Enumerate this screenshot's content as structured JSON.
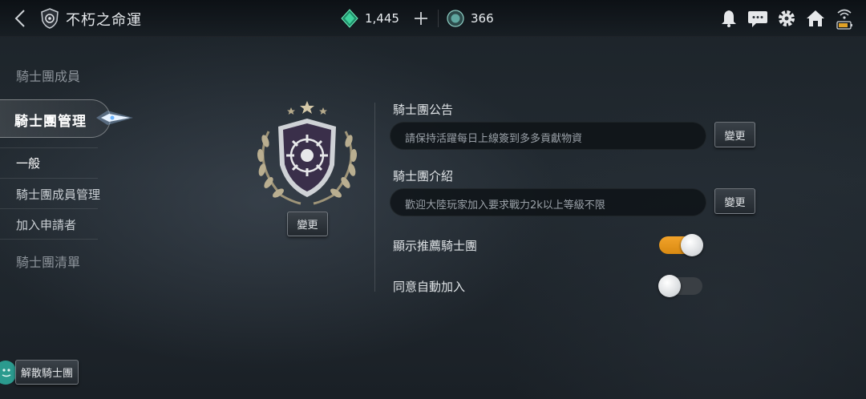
{
  "header": {
    "title": "不朽之命運",
    "currency": [
      {
        "name": "green-gem",
        "amount": "1,445",
        "color": "#2fbf8c"
      },
      {
        "name": "teal-coin",
        "amount": "366",
        "color": "#5fa7a0"
      }
    ]
  },
  "sidebar": {
    "members": "騎士團成員",
    "management": "騎士團管理",
    "sub": [
      "一般",
      "騎士團成員管理",
      "加入申請者"
    ],
    "list": "騎士團清單"
  },
  "emblem": {
    "change_label": "變更"
  },
  "notice": {
    "label": "騎士團公告",
    "value": "請保持活躍每日上線簽到多多貢獻物資",
    "change_label": "變更"
  },
  "intro": {
    "label": "騎士團介紹",
    "value": "歡迎大陸玩家加入要求戰力2k以上等級不限",
    "change_label": "變更"
  },
  "toggles": [
    {
      "label": "顯示推薦騎士團",
      "on": true
    },
    {
      "label": "同意自動加入",
      "on": false
    }
  ],
  "disband_label": "解散騎士團",
  "colors": {
    "accent": "#f2a32a",
    "gem": "#2fbf8c"
  }
}
